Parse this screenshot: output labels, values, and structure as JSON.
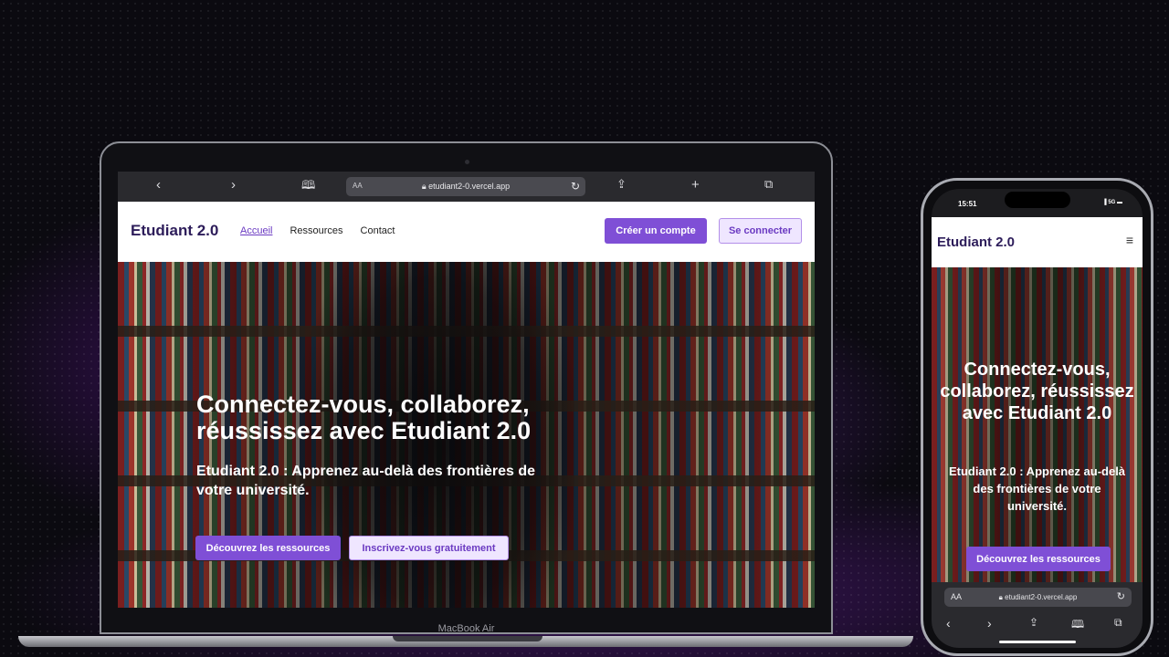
{
  "laptop": {
    "model_label": "MacBook Air",
    "browser": {
      "address_prefix": "AA",
      "url": "etudiant2-0.vercel.app",
      "icons": [
        "back-icon",
        "forward-icon",
        "bookmarks-icon",
        "lock-icon",
        "reload-icon",
        "share-icon",
        "new-tab-icon",
        "tabs-icon"
      ]
    }
  },
  "site": {
    "logo": "Etudiant 2.0",
    "nav": {
      "home": "Accueil",
      "resources": "Ressources",
      "contact": "Contact"
    },
    "header_buttons": {
      "create_account": "Créer un compte",
      "login": "Se connecter"
    },
    "hero": {
      "title": "Connectez-vous, collaborez, réussissez avec Etudiant 2.0",
      "subtitle": "Etudiant 2.0 : Apprenez au-delà des frontières de votre université.",
      "cta_primary": "Découvrez les ressources",
      "cta_secondary": "Inscrivez-vous gratuitement"
    }
  },
  "phone": {
    "time": "15:51",
    "network": "5G",
    "address_prefix": "AA",
    "url": "etudiant2-0.vercel.app",
    "logo": "Etudiant 2.0",
    "hero_title": "Connectez-vous, collaborez, réussissez avec Etudiant 2.0",
    "hero_subtitle": "Etudiant 2.0 : Apprenez au-delà des frontières de votre université.",
    "cta_primary": "Découvrez les ressources"
  },
  "colors": {
    "brand_purple": "#7f4fd6",
    "light_purple": "#efe6ff",
    "logo_dark": "#2d1d5a"
  }
}
